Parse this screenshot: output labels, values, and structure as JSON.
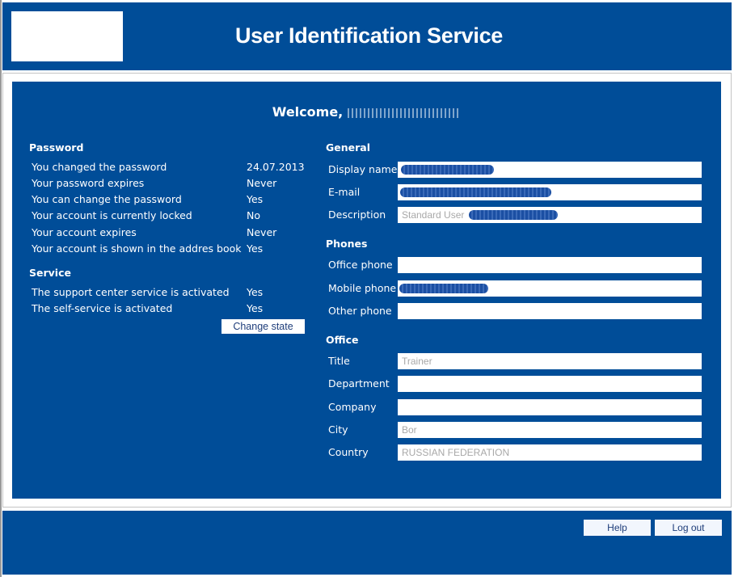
{
  "header": {
    "title": "User Identification Service",
    "brand_color": "#004d98"
  },
  "welcome": {
    "prefix": "Welcome,",
    "name": "(redacted)"
  },
  "password_section": {
    "title": "Password",
    "rows": [
      {
        "label": "You changed the password",
        "value": "24.07.2013"
      },
      {
        "label": "Your password expires",
        "value": "Never"
      },
      {
        "label": "You can change the password",
        "value": "Yes"
      },
      {
        "label": "Your account is currently locked",
        "value": "No"
      },
      {
        "label": "Your account expires",
        "value": "Never"
      },
      {
        "label": "Your account is shown in the addres book",
        "value": "Yes"
      }
    ]
  },
  "service_section": {
    "title": "Service",
    "rows": [
      {
        "label": "The support center service is activated",
        "value": "Yes"
      },
      {
        "label": "The self-service is activated",
        "value": "Yes"
      }
    ],
    "change_state_label": "Change state"
  },
  "general_section": {
    "title": "General",
    "fields": [
      {
        "label": "Display name",
        "value": "",
        "redacted": true
      },
      {
        "label": "E-mail",
        "value": "",
        "redacted": true
      },
      {
        "label": "Description",
        "value": "Standard User",
        "redacted": true
      }
    ]
  },
  "phones_section": {
    "title": "Phones",
    "fields": [
      {
        "label": "Office phone",
        "value": ""
      },
      {
        "label": "Mobile phone",
        "value": "",
        "redacted": true
      },
      {
        "label": "Other phone",
        "value": ""
      }
    ]
  },
  "office_section": {
    "title": "Office",
    "fields": [
      {
        "label": "Title",
        "value": "Trainer"
      },
      {
        "label": "Department",
        "value": ""
      },
      {
        "label": "Company",
        "value": ""
      },
      {
        "label": "City",
        "value": "Bor"
      },
      {
        "label": "Country",
        "value": "RUSSIAN FEDERATION"
      }
    ]
  },
  "footer": {
    "help_label": "Help",
    "logout_label": "Log out"
  }
}
